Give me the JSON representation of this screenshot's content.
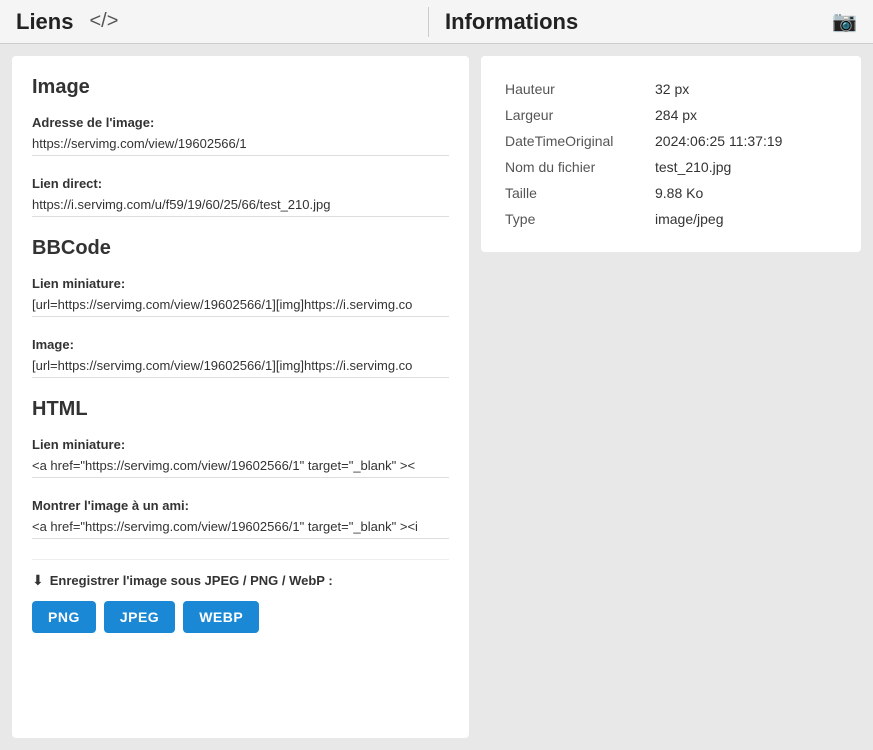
{
  "header": {
    "left_title": "Liens",
    "code_icon": "</>",
    "right_title": "Informations",
    "camera_icon": "📷"
  },
  "left_panel": {
    "image_section": {
      "title": "Image",
      "fields": [
        {
          "label": "Adresse de l'image:",
          "value": "https://servimg.com/view/19602566/1"
        },
        {
          "label": "Lien direct:",
          "value": "https://i.servimg.com/u/f59/19/60/25/66/test_210.jpg"
        }
      ]
    },
    "bbcode_section": {
      "title": "BBCode",
      "fields": [
        {
          "label": "Lien miniature:",
          "value": "[url=https://servimg.com/view/19602566/1][img]https://i.servimg.co"
        },
        {
          "label": "Image:",
          "value": "[url=https://servimg.com/view/19602566/1][img]https://i.servimg.co"
        }
      ]
    },
    "html_section": {
      "title": "HTML",
      "fields": [
        {
          "label": "Lien miniature:",
          "value": "<a href=\"https://servimg.com/view/19602566/1\" target=\"_blank\" ><"
        },
        {
          "label": "Montrer l'image à un ami:",
          "value": "<a href=\"https://servimg.com/view/19602566/1\" target=\"_blank\" ><i"
        }
      ]
    },
    "download": {
      "label": "Enregistrer l'image sous JPEG / PNG / WebP :",
      "buttons": [
        "PNG",
        "JPEG",
        "WEBP"
      ]
    }
  },
  "right_panel": {
    "info": {
      "rows": [
        {
          "key": "Hauteur",
          "value": "32 px"
        },
        {
          "key": "Largeur",
          "value": "284 px"
        },
        {
          "key": "DateTimeOriginal",
          "value": "2024:06:25 11:37:19"
        },
        {
          "key": "Nom du fichier",
          "value": "test_210.jpg"
        },
        {
          "key": "Taille",
          "value": "9.88 Ko"
        },
        {
          "key": "Type",
          "value": "image/jpeg"
        }
      ]
    }
  }
}
